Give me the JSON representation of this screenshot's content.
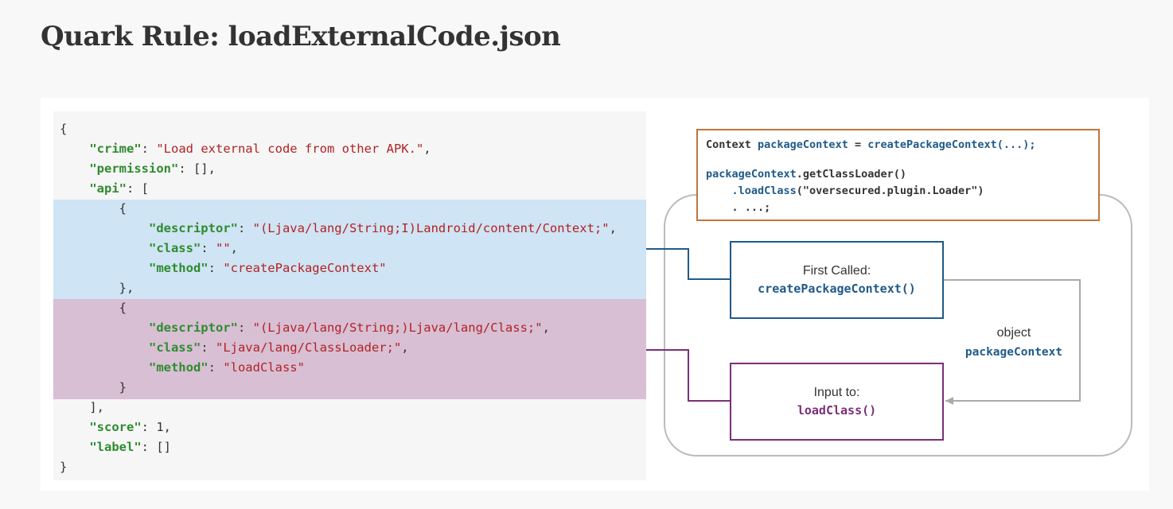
{
  "page": {
    "title": "Quark Rule: loadExternalCode.json"
  },
  "rule_json": {
    "lines": [
      [
        {
          "t": "{",
          "c": "p"
        }
      ],
      [
        {
          "t": "    ",
          "c": "p"
        },
        {
          "t": "\"crime\"",
          "c": "k"
        },
        {
          "t": ": ",
          "c": "p"
        },
        {
          "t": "\"Load external code from other APK.\"",
          "c": "s"
        },
        {
          "t": ",",
          "c": "p"
        }
      ],
      [
        {
          "t": "    ",
          "c": "p"
        },
        {
          "t": "\"permission\"",
          "c": "k"
        },
        {
          "t": ": [],",
          "c": "p"
        }
      ],
      [
        {
          "t": "    ",
          "c": "p"
        },
        {
          "t": "\"api\"",
          "c": "k"
        },
        {
          "t": ": [",
          "c": "p"
        }
      ],
      [
        {
          "t": "        {",
          "c": "p"
        }
      ],
      [
        {
          "t": "            ",
          "c": "p"
        },
        {
          "t": "\"descriptor\"",
          "c": "k"
        },
        {
          "t": ": ",
          "c": "p"
        },
        {
          "t": "\"(Ljava/lang/String;I)Landroid/content/Context;\"",
          "c": "s"
        },
        {
          "t": ",",
          "c": "p"
        }
      ],
      [
        {
          "t": "            ",
          "c": "p"
        },
        {
          "t": "\"class\"",
          "c": "k"
        },
        {
          "t": ": ",
          "c": "p"
        },
        {
          "t": "\"\"",
          "c": "s"
        },
        {
          "t": ",",
          "c": "p"
        }
      ],
      [
        {
          "t": "            ",
          "c": "p"
        },
        {
          "t": "\"method\"",
          "c": "k"
        },
        {
          "t": ": ",
          "c": "p"
        },
        {
          "t": "\"createPackageContext\"",
          "c": "s"
        }
      ],
      [
        {
          "t": "        },",
          "c": "p"
        }
      ],
      [
        {
          "t": "        {",
          "c": "p"
        }
      ],
      [
        {
          "t": "            ",
          "c": "p"
        },
        {
          "t": "\"descriptor\"",
          "c": "k"
        },
        {
          "t": ": ",
          "c": "p"
        },
        {
          "t": "\"(Ljava/lang/String;)Ljava/lang/Class;\"",
          "c": "s"
        },
        {
          "t": ",",
          "c": "p"
        }
      ],
      [
        {
          "t": "            ",
          "c": "p"
        },
        {
          "t": "\"class\"",
          "c": "k"
        },
        {
          "t": ": ",
          "c": "p"
        },
        {
          "t": "\"Ljava/lang/ClassLoader;\"",
          "c": "s"
        },
        {
          "t": ",",
          "c": "p"
        }
      ],
      [
        {
          "t": "            ",
          "c": "p"
        },
        {
          "t": "\"method\"",
          "c": "k"
        },
        {
          "t": ": ",
          "c": "p"
        },
        {
          "t": "\"loadClass\"",
          "c": "s"
        }
      ],
      [
        {
          "t": "        }",
          "c": "p"
        }
      ],
      [
        {
          "t": "    ],",
          "c": "p"
        }
      ],
      [
        {
          "t": "    ",
          "c": "p"
        },
        {
          "t": "\"score\"",
          "c": "k"
        },
        {
          "t": ": 1,",
          "c": "p"
        }
      ],
      [
        {
          "t": "    ",
          "c": "p"
        },
        {
          "t": "\"label\"",
          "c": "k"
        },
        {
          "t": ": []",
          "c": "p"
        }
      ],
      [
        {
          "t": "}",
          "c": "p"
        }
      ]
    ]
  },
  "code_snippet": {
    "line1_prefix": "Context ",
    "line1_var": "packageContext",
    "line1_mid": " = ",
    "line1_call": "createPackageContext(...);",
    "line2_var": "packageContext",
    "line2_rest": ".getClassLoader()",
    "line3_indent": "    ",
    "line3_call": ".loadClass",
    "line3_arg": "(\"oversecured.plugin.Loader\")",
    "line4": "    . ...;"
  },
  "flow": {
    "first_called_label": "First Called:",
    "first_called_method": "createPackageContext()",
    "input_label": "Input to:",
    "input_method": "loadClass()",
    "object_label": "object",
    "object_name": "packageContext"
  },
  "colors": {
    "blue": "#1f5a8a",
    "purple": "#7a2f7a",
    "orange": "#c0753a",
    "highlight_blue": "#cfe4f4",
    "highlight_pink": "#d8bfd4",
    "key_green": "#2e8b2e",
    "string_red": "#b22222"
  }
}
